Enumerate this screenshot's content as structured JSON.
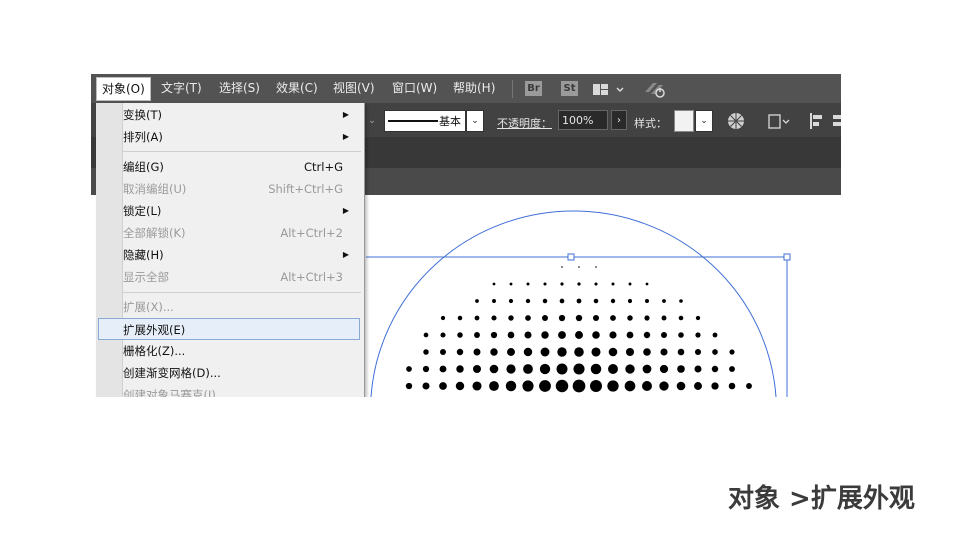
{
  "menubar": {
    "items": [
      {
        "label": "对象(O)"
      },
      {
        "label": "文字(T)"
      },
      {
        "label": "选择(S)"
      },
      {
        "label": "效果(C)"
      },
      {
        "label": "视图(V)"
      },
      {
        "label": "窗口(W)"
      },
      {
        "label": "帮助(H)"
      }
    ],
    "br_badge": "Br",
    "st_badge": "St"
  },
  "control_bar": {
    "stroke_profile_label": "基本",
    "opacity_label": "不透明度：",
    "opacity_value": "100%",
    "style_label": "样式："
  },
  "object_menu": {
    "items": [
      {
        "label": "变换(T)",
        "shortcut": "",
        "submenu": true,
        "disabled": false
      },
      {
        "label": "排列(A)",
        "shortcut": "",
        "submenu": true,
        "disabled": false
      },
      {
        "label": "编组(G)",
        "shortcut": "Ctrl+G",
        "submenu": false,
        "disabled": false
      },
      {
        "label": "取消编组(U)",
        "shortcut": "Shift+Ctrl+G",
        "submenu": false,
        "disabled": true
      },
      {
        "label": "锁定(L)",
        "shortcut": "",
        "submenu": true,
        "disabled": false
      },
      {
        "label": "全部解锁(K)",
        "shortcut": "Alt+Ctrl+2",
        "submenu": false,
        "disabled": true
      },
      {
        "label": "隐藏(H)",
        "shortcut": "",
        "submenu": true,
        "disabled": false
      },
      {
        "label": "显示全部",
        "shortcut": "Alt+Ctrl+3",
        "submenu": false,
        "disabled": true
      },
      {
        "label": "扩展(X)...",
        "shortcut": "",
        "submenu": false,
        "disabled": true
      },
      {
        "label": "扩展外观(E)",
        "shortcut": "",
        "submenu": false,
        "disabled": false,
        "highlighted": true
      },
      {
        "label": "栅格化(Z)...",
        "shortcut": "",
        "submenu": false,
        "disabled": false
      },
      {
        "label": "创建渐变网格(D)...",
        "shortcut": "",
        "submenu": false,
        "disabled": false
      },
      {
        "label": "创建对象马赛克(J)...",
        "shortcut": "",
        "submenu": false,
        "disabled": true
      }
    ]
  },
  "caption": "对象 >扩展外观",
  "colors": {
    "menubar_bg": "#535353",
    "control_bg": "#424242",
    "selection_blue": "#3f6fd6",
    "highlight_bg": "#e6eef9",
    "caption_text": "#3b3b3b"
  }
}
